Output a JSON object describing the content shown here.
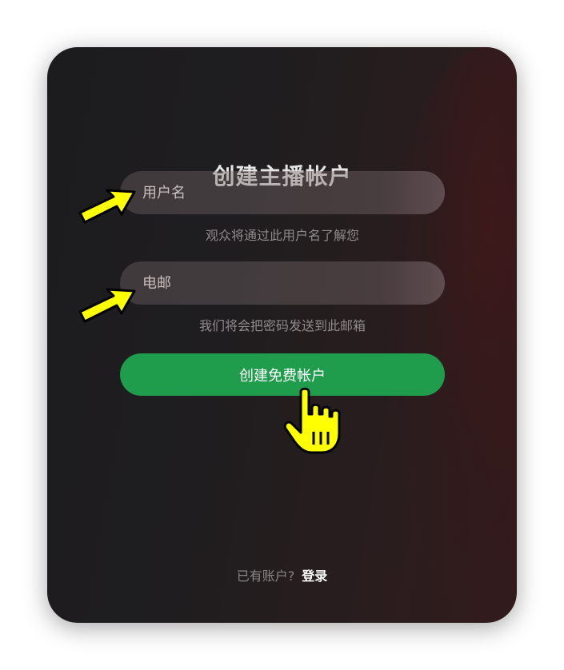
{
  "form": {
    "title": "创建主播帐户",
    "username_placeholder": "用户名",
    "username_hint": "观众将通过此用户名了解您",
    "email_placeholder": "电邮",
    "email_hint": "我们将会把密码发送到此邮箱",
    "submit_label": "创建免费帐户"
  },
  "footer": {
    "question": "已有账户?",
    "login_label": "登录"
  },
  "colors": {
    "accent_green": "#1f9d4c",
    "pointer_yellow": "#ffff00"
  },
  "icons": {
    "arrows": "pointer-arrow-icon",
    "cursor": "hand-cursor-icon"
  }
}
